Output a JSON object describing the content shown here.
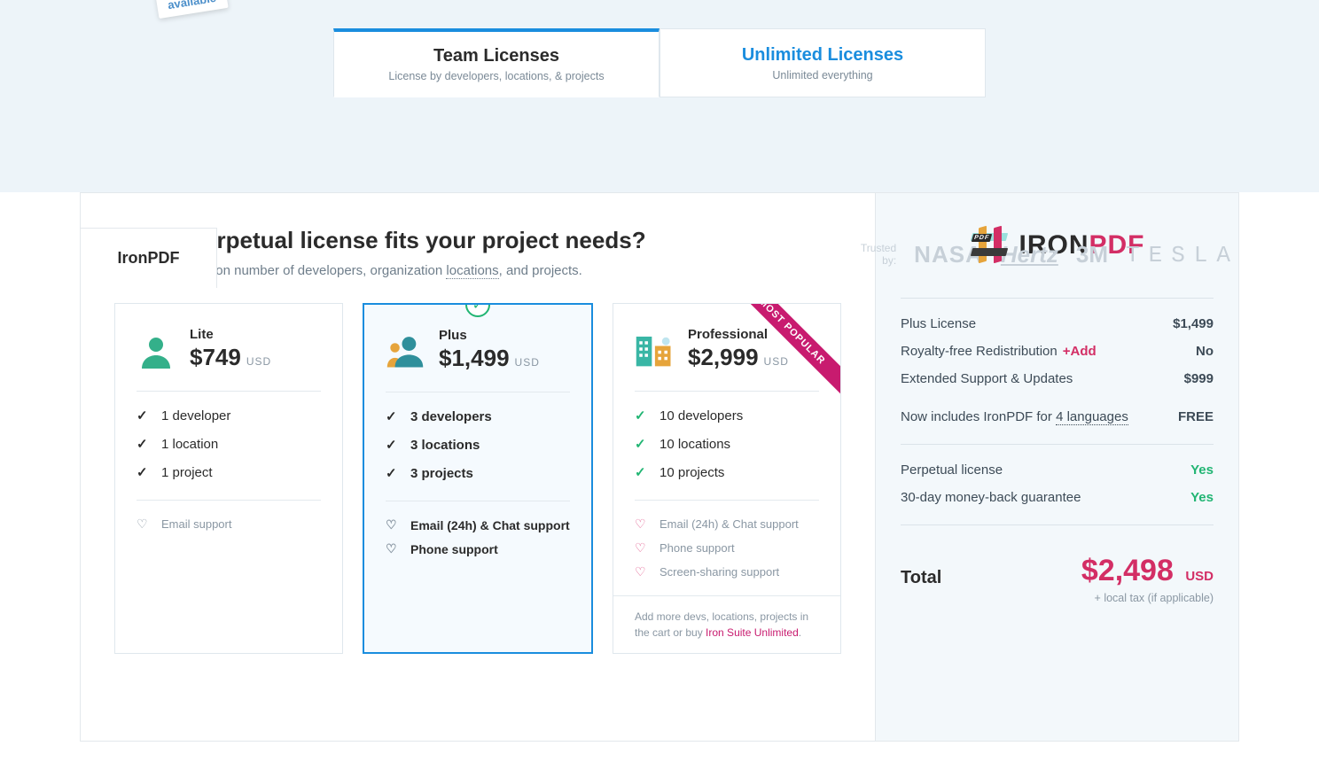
{
  "sticker": "available",
  "tabs": {
    "team": {
      "title": "Team Licenses",
      "sub": "License by developers, locations, & projects"
    },
    "unlimited": {
      "title": "Unlimited Licenses",
      "sub": "Unlimited everything"
    }
  },
  "productTab": "IronPDF",
  "trustedLabel": "Trusted by:",
  "brands": [
    "NASA",
    "Hertz",
    "3M",
    "TESLA"
  ],
  "heading": "Which perpetual license fits your project needs?",
  "subheading_a": "Coverage based on number of developers, organization ",
  "subheading_u": "locations",
  "subheading_b": ", and projects.",
  "plans": {
    "lite": {
      "name": "Lite",
      "price": "$749",
      "currency": "USD",
      "features": [
        "1 developer",
        "1 location",
        "1 project"
      ],
      "support": [
        "Email support"
      ]
    },
    "plus": {
      "name": "Plus",
      "price": "$1,499",
      "currency": "USD",
      "features": [
        "3 developers",
        "3 locations",
        "3 projects"
      ],
      "support": [
        "Email (24h) & Chat support",
        "Phone support"
      ]
    },
    "pro": {
      "name": "Professional",
      "price": "$2,999",
      "currency": "USD",
      "badge": "MOST POPULAR",
      "features": [
        "10 developers",
        "10 locations",
        "10 projects"
      ],
      "support": [
        "Email (24h) & Chat support",
        "Phone support",
        "Screen-sharing support"
      ],
      "note_a": "Add more devs, locations, projects in the cart or buy ",
      "note_link": "Iron Suite Unlimited",
      "note_b": "."
    }
  },
  "summary": {
    "logo_a": "IRON",
    "logo_b": "PDF",
    "logo_pdf": "PDF",
    "rows": {
      "license": {
        "label": "Plus License",
        "value": "$1,499"
      },
      "royalty": {
        "label": "Royalty-free Redistribution",
        "add": "+Add",
        "value": "No"
      },
      "support": {
        "label": "Extended Support & Updates",
        "value": "$999"
      },
      "includes_a": "Now includes IronPDF for ",
      "includes_u": "4 languages",
      "includes_val": "FREE",
      "perpetual": {
        "label": "Perpetual license",
        "value": "Yes"
      },
      "moneyback": {
        "label": "30-day money-back guarantee",
        "value": "Yes"
      }
    },
    "total_label": "Total",
    "total_amount": "$2,498",
    "total_currency": "USD",
    "tax": "+ local tax (if applicable)"
  }
}
